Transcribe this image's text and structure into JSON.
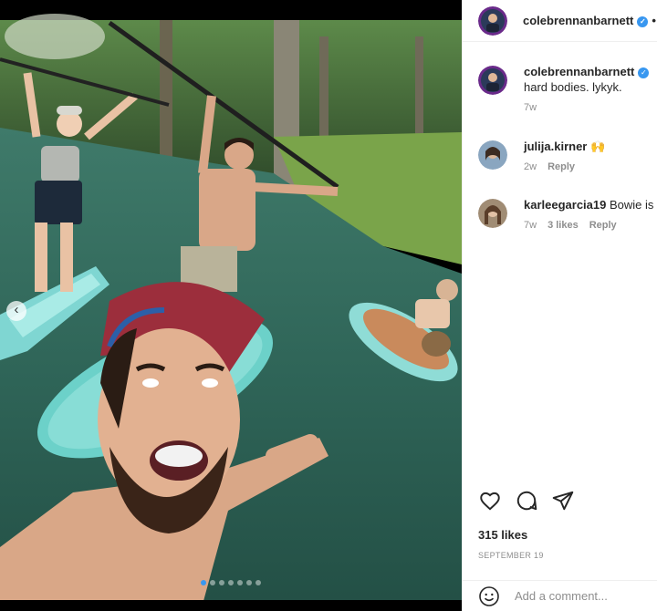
{
  "post": {
    "author": "colebrennanbarnett",
    "verified": true,
    "separator": "•",
    "photo_alt": "Selfie of friends paddleboarding on a river"
  },
  "comments": [
    {
      "user": "colebrennanbarnett",
      "verified": true,
      "text": "hard bodies. lykyk.",
      "time": "7w",
      "likes": "",
      "reply": ""
    },
    {
      "user": "julija.kirner",
      "verified": false,
      "text": "🙌",
      "time": "2w",
      "likes": "",
      "reply": "Reply"
    },
    {
      "user": "karleegarcia19",
      "verified": false,
      "text": "Bowie is",
      "time": "7w",
      "likes": "3 likes",
      "reply": "Reply"
    }
  ],
  "stats": {
    "likes": "315 likes",
    "date": "SEPTEMBER 19"
  },
  "composer": {
    "placeholder": "Add a comment..."
  },
  "carousel": {
    "slides": 7,
    "current": 1
  },
  "icons": [
    "heart-icon",
    "comment-icon",
    "share-icon",
    "emoji-icon",
    "chevron-left-icon",
    "verified-badge-icon"
  ],
  "colors": {
    "verified_blue": "#3897f0",
    "muted_text": "#8e8e8e",
    "text": "#262626"
  }
}
